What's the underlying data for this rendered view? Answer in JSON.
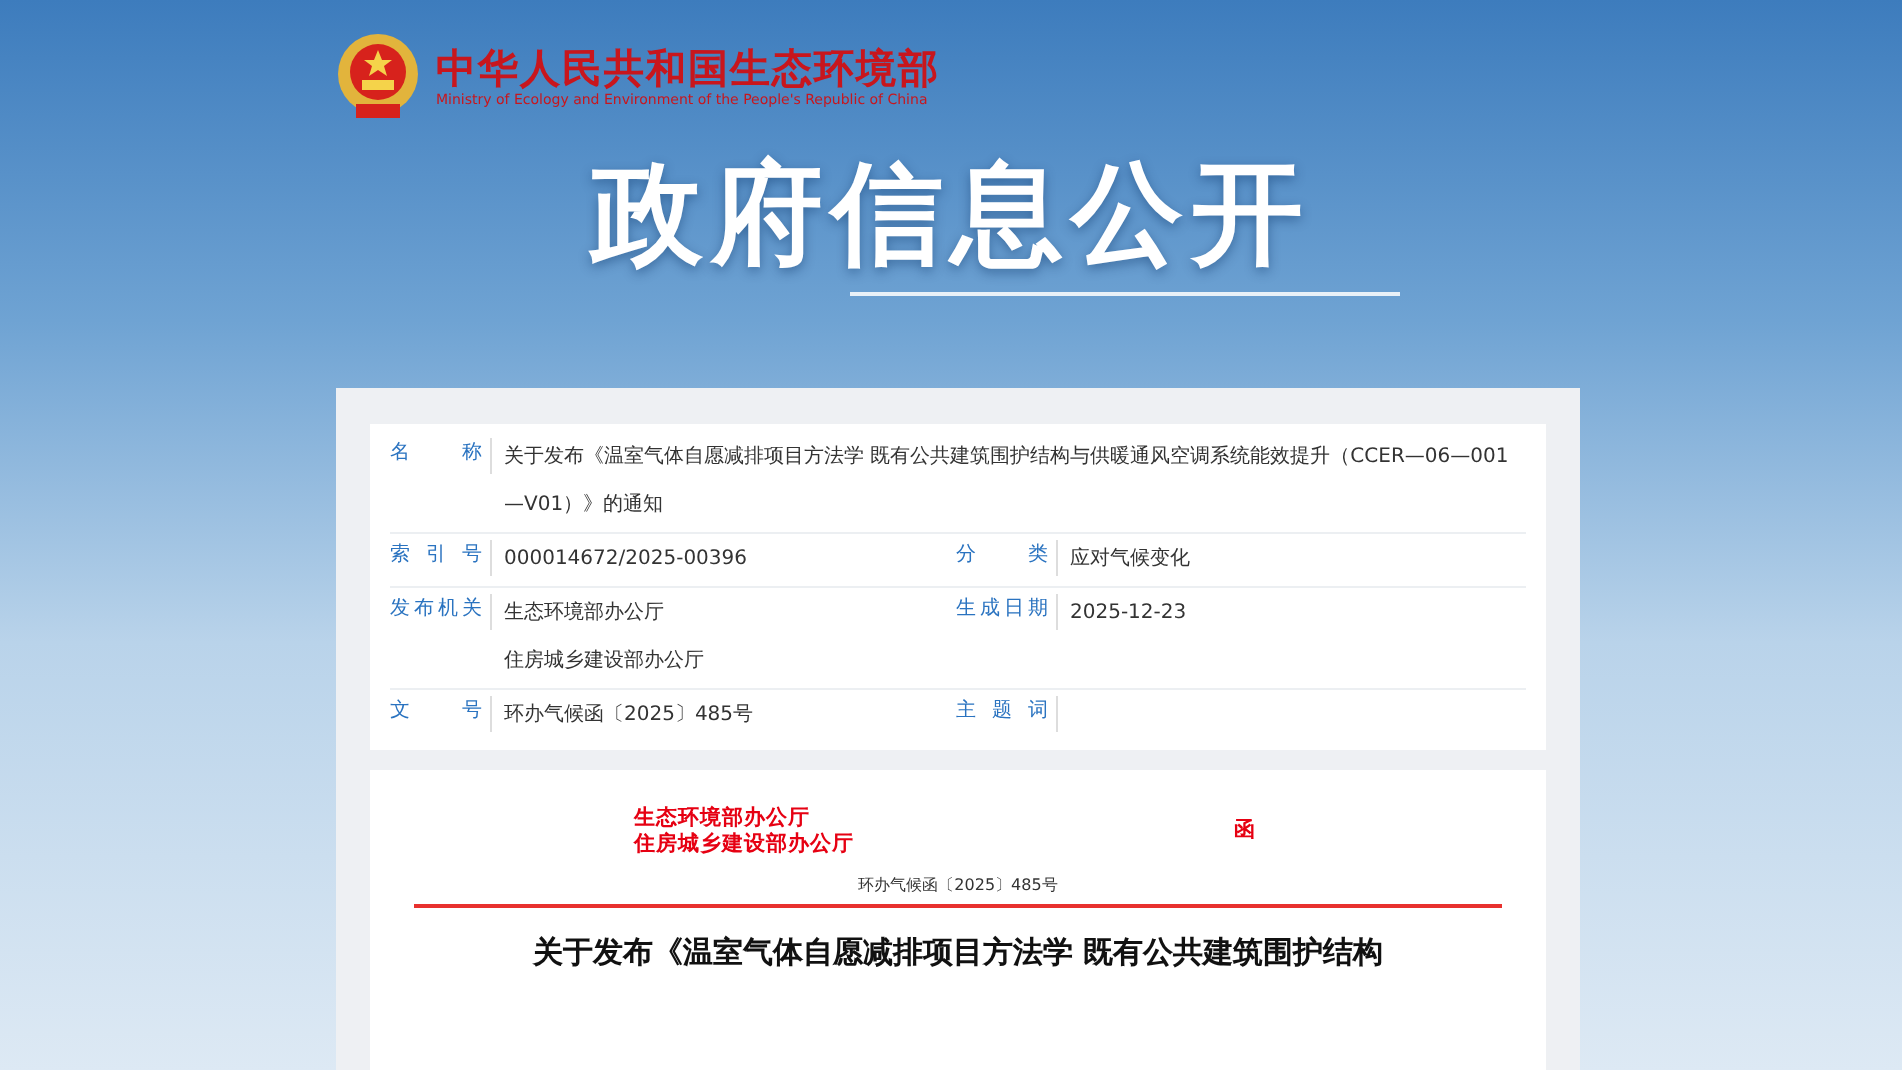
{
  "header": {
    "org_name": "中华人民共和国生态环境部",
    "org_name_en": "Ministry of Ecology and Environment of the People's Republic of China"
  },
  "banner_title": "政府信息公开",
  "metadata": [
    {
      "cells": [
        {
          "label": "名称",
          "values": [
            "关于发布《温室气体自愿减排项目方法学 既有公共建筑围护结构与供暖通风空调系统能效提升（CCER—06—001—V01）》的通知"
          ]
        }
      ]
    },
    {
      "cells": [
        {
          "label": "索引号",
          "values": [
            "000014672/2025-00396"
          ]
        },
        {
          "label": "分类",
          "values": [
            "应对气候变化"
          ]
        }
      ]
    },
    {
      "cells": [
        {
          "label": "发布机关",
          "values": [
            "生态环境部办公厅",
            "住房城乡建设部办公厅"
          ]
        },
        {
          "label": "生成日期",
          "values": [
            "2025-12-23"
          ]
        }
      ]
    },
    {
      "cells": [
        {
          "label": "文号",
          "values": [
            "环办气候函〔2025〕485号"
          ]
        },
        {
          "label": "主题词"
        }
      ]
    }
  ],
  "document": {
    "issuers": [
      "生态环境部办公厅",
      "住房城乡建设部办公厅"
    ],
    "doc_type": "函",
    "doc_number": "环办气候函〔2025〕485号",
    "heading": "关于发布《温室气体自愿减排项目方法学 既有公共建筑围护结构"
  }
}
